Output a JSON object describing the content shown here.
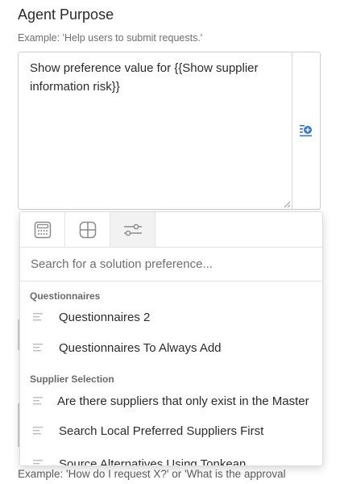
{
  "agent_purpose": {
    "title": "Agent Purpose",
    "help": "Example: 'Help users to submit requests.'",
    "value_line1": "Show preference value for {{Show supplier",
    "value_line2": "information risk}}"
  },
  "preference_picker": {
    "tabs": [
      {
        "icon": "calculator-icon",
        "active": false
      },
      {
        "icon": "grid-icon",
        "active": false
      },
      {
        "icon": "settings-sliders-icon",
        "active": true
      }
    ],
    "search_placeholder": "Search for a solution preference...",
    "groups": [
      {
        "label": "Questionnaires",
        "items": [
          "Questionnaires 2",
          "Questionnaires To Always Add"
        ]
      },
      {
        "label": "Supplier Selection",
        "items": [
          "Are there suppliers that only exist in the Master",
          "Search Local Preferred Suppliers First",
          "Source Alternatives Using Tonkean"
        ]
      }
    ]
  },
  "next_field": {
    "help": "Example: 'How do I request X?' or 'What is the approval"
  },
  "colors": {
    "accent": "#3a78c3",
    "border": "#cfcfcf",
    "muted_text": "#6f6f6f"
  }
}
